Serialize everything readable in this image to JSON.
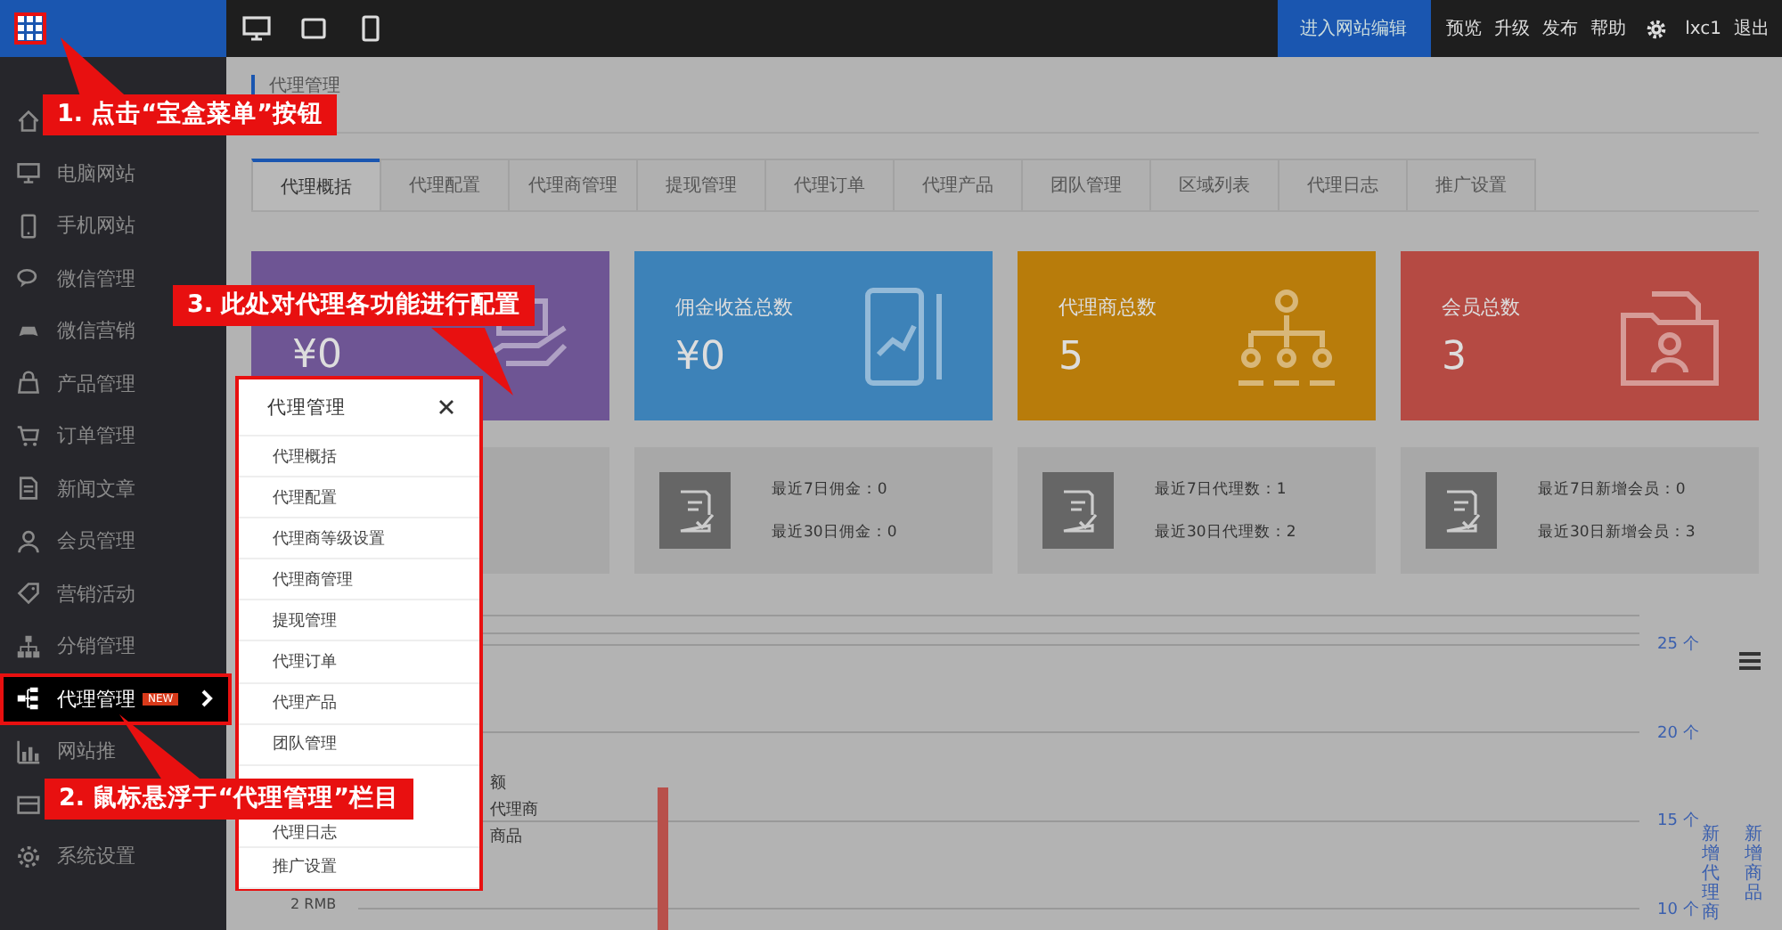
{
  "topbar": {
    "edit_button": "进入网站编辑",
    "links": [
      "预览",
      "升级",
      "发布",
      "帮助"
    ],
    "user": "lxc1",
    "logout": "退出"
  },
  "sidebar": {
    "items": [
      {
        "selected": false
      },
      {
        "label": "电脑网站",
        "selected": false
      },
      {
        "label": "手机网站",
        "selected": false
      },
      {
        "label": "微信管理",
        "selected": false
      },
      {
        "label": "微信营销",
        "selected": false
      },
      {
        "label": "产品管理",
        "selected": false
      },
      {
        "label": "订单管理",
        "selected": false
      },
      {
        "label": "新闻文章",
        "selected": false
      },
      {
        "label": "会员管理",
        "selected": false
      },
      {
        "label": "营销活动",
        "selected": false
      },
      {
        "label": "分销管理",
        "selected": false
      },
      {
        "label": "代理管理",
        "badge": "NEW",
        "selected": true
      },
      {
        "label": "网站推",
        "selected": false
      },
      {
        "selected": false
      },
      {
        "label": "系统设置",
        "selected": false
      }
    ]
  },
  "breadcrumb": "代理管理",
  "tabs": [
    {
      "label": "代理概括",
      "selected": true
    },
    {
      "label": "代理配置",
      "selected": false
    },
    {
      "label": "代理商管理",
      "selected": false
    },
    {
      "label": "提现管理",
      "selected": false
    },
    {
      "label": "代理订单",
      "selected": false
    },
    {
      "label": "代理产品",
      "selected": false
    },
    {
      "label": "团队管理",
      "selected": false
    },
    {
      "label": "区域列表",
      "selected": false
    },
    {
      "label": "代理日志",
      "selected": false
    },
    {
      "label": "推广设置",
      "selected": false
    }
  ],
  "stat_cards": [
    {
      "value": "¥0",
      "color": "#6e5594"
    },
    {
      "label": "佣金收益总数",
      "value": "¥0",
      "color": "#3d82b8"
    },
    {
      "label": "代理商总数",
      "value": "5",
      "color": "#b87c0b"
    },
    {
      "label": "会员总数",
      "value": "3",
      "color": "#b54a43"
    }
  ],
  "detail_cards": [
    {
      "lines": [
        "最近7日佣金：0",
        "最近30日佣金：0"
      ]
    },
    {
      "lines": [
        "最近7日代理数：1",
        "最近30日代理数：2"
      ]
    },
    {
      "lines": [
        "最近7日新增会员：0",
        "最近30日新增会员：3"
      ]
    }
  ],
  "chart": {
    "left_tick": "2 RMB",
    "right_ticks": [
      "25 个",
      "20 个",
      "15 个",
      "10 个"
    ],
    "legend": [
      "额",
      "代理商",
      "商品"
    ],
    "right_titles": [
      "新增代理商",
      "新增商品"
    ]
  },
  "popup": {
    "title": "代理管理",
    "items": [
      "代理概括",
      "代理配置",
      "代理商等级设置",
      "代理商管理",
      "提现管理",
      "代理订单",
      "代理产品",
      "团队管理",
      "代理日志",
      "推广设置"
    ]
  },
  "callouts": [
    "1. 点击“宝盒菜单”按钮",
    "3. 此处对代理各功能进行配置",
    "2. 鼠标悬浮于“代理管理”栏目"
  ]
}
